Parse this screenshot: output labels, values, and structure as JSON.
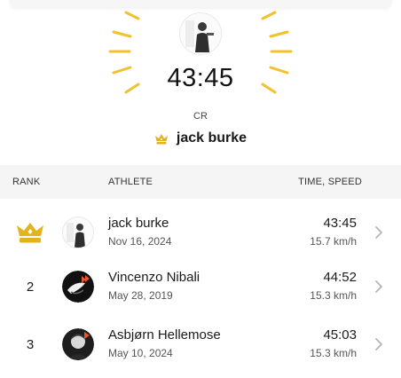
{
  "hero": {
    "time": "43:45",
    "label": "CR",
    "name": "jack burke"
  },
  "table": {
    "headers": {
      "rank": "RANK",
      "athlete": "ATHLETE",
      "time_speed": "TIME, SPEED"
    },
    "rows": [
      {
        "rank": "",
        "crown": true,
        "name": "jack burke",
        "date": "Nov 16, 2024",
        "time": "43:45",
        "speed": "15.7 km/h"
      },
      {
        "rank": "2",
        "crown": false,
        "name": "Vincenzo Nibali",
        "date": "May 28, 2019",
        "time": "44:52",
        "speed": "15.3 km/h"
      },
      {
        "rank": "3",
        "crown": false,
        "name": "Asbjørn Hellemose",
        "date": "May 10, 2024",
        "time": "45:03",
        "speed": "15.3 km/h"
      }
    ]
  },
  "colors": {
    "gold": "#f2c12e",
    "crown": "#e3b31c",
    "chevron": "#b5b5b5",
    "header_bg": "#f5f5f5"
  },
  "icons": [
    "crown-icon",
    "chevron-right-icon",
    "sun-ray-icon"
  ]
}
